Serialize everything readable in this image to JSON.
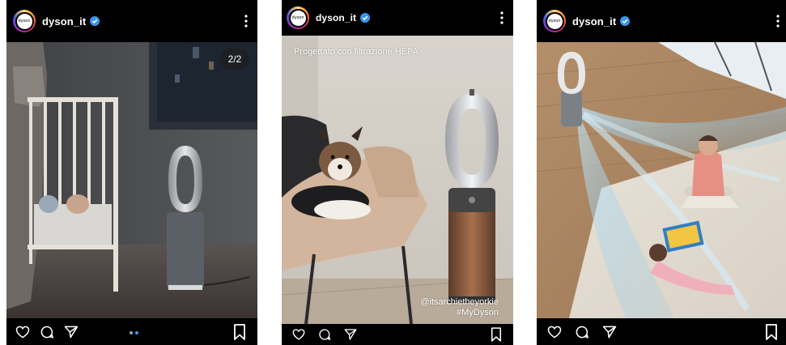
{
  "posts": [
    {
      "username": "dyson_it",
      "avatar_text": "dyson",
      "media_counter": "2/2",
      "caption_overlay": "",
      "tag_overlay": "",
      "hashtag_overlay": ""
    },
    {
      "username": "dyson_it",
      "avatar_text": "dyson",
      "media_counter": "",
      "caption_overlay": "Progettato con filtrazione HEPA",
      "tag_overlay": "@itsarchietheyorkie",
      "hashtag_overlay": "#MyDyson"
    },
    {
      "username": "dyson_it",
      "avatar_text": "dyson",
      "media_counter": "",
      "caption_overlay": "",
      "tag_overlay": "",
      "hashtag_overlay": ""
    }
  ],
  "colors": {
    "post_background": "#000000",
    "verified_badge": "#3897f0",
    "carousel_dot_active": "#3897f0"
  },
  "icons": [
    "heart-icon",
    "comment-icon",
    "share-icon",
    "bookmark-icon",
    "more-vertical-icon",
    "verified-badge-icon"
  ]
}
